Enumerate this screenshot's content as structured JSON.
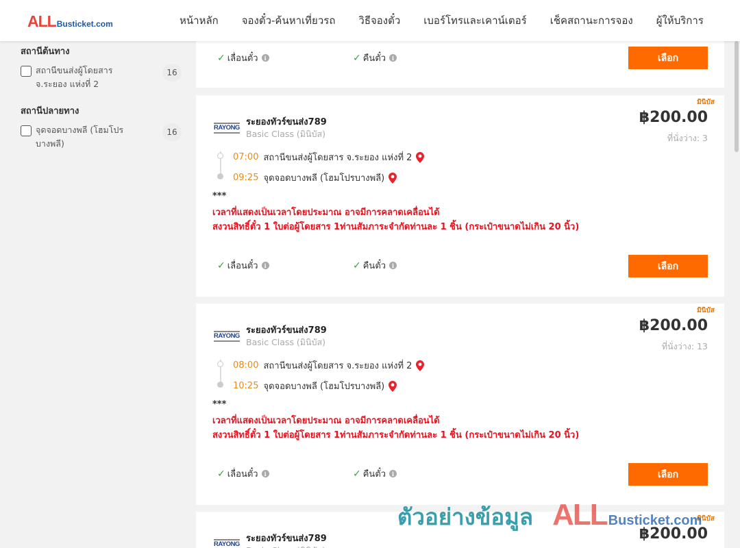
{
  "header": {
    "logo_big": "ALL",
    "logo_small": "Busticket.com",
    "nav": [
      {
        "label": "หน้าหลัก"
      },
      {
        "label": "จองตั๋ว-ค้นหาเที่ยวรถ"
      },
      {
        "label": "วิธีจองตั๋ว"
      },
      {
        "label": "เบอร์โทรและเคาน์เตอร์"
      },
      {
        "label": "เช็คสถานะการจอง"
      },
      {
        "label": "ผู้ให้บริการ"
      }
    ]
  },
  "sidebar": {
    "origin": {
      "title": "สถานีต้นทาง",
      "option_label": "สถานีขนส่งผู้โดยสาร จ.ระยอง แห่งที่ 2",
      "count": "16"
    },
    "destination": {
      "title": "สถานีปลายทาง",
      "option_label": "จุดจอดบางพลี (โฮมโปรบางพลี)",
      "count": "16"
    }
  },
  "features": {
    "change_label": "เลื่อนตั๋ว",
    "refund_label": "คืนตั๋ว",
    "info_glyph": "i",
    "select_label": "เลือก"
  },
  "trips": [
    {
      "badge": "มินิบัส",
      "logo_text": "RAYONG",
      "operator": "ระยองทัวร์ขนส่ง789",
      "class": "Basic Class (มินิบัส)",
      "price": "฿200.00",
      "seats": "ที่นั่งว่าง: 3",
      "depart_time": "07:00",
      "depart_place": "สถานีขนส่งผู้โดยสาร จ.ระยอง แห่งที่ 2",
      "arrive_time": "09:25",
      "arrive_place": "จุดจอดบางพลี (โฮมโปรบางพลี)",
      "stars": "***",
      "note1": "เวลาที่แสดงเป็นเวลาโดยประมาณ อาจมีการคลาดเคลื่อนได้",
      "note2": "สงวนสิทธิ์ตั๋ว 1 ใบต่อผู้โดยสาร 1ท่านสัมภาระจำกัดท่านละ 1 ชิ้น (กระเป๋าขนาดไม่เกิน 20 นิ้ว)"
    },
    {
      "badge": "มินิบัส",
      "logo_text": "RAYONG",
      "operator": "ระยองทัวร์ขนส่ง789",
      "class": "Basic Class (มินิบัส)",
      "price": "฿200.00",
      "seats": "ที่นั่งว่าง: 13",
      "depart_time": "08:00",
      "depart_place": "สถานีขนส่งผู้โดยสาร จ.ระยอง แห่งที่ 2",
      "arrive_time": "10:25",
      "arrive_place": "จุดจอดบางพลี (โฮมโปรบางพลี)",
      "stars": "***",
      "note1": "เวลาที่แสดงเป็นเวลาโดยประมาณ อาจมีการคลาดเคลื่อนได้",
      "note2": "สงวนสิทธิ์ตั๋ว 1 ใบต่อผู้โดยสาร 1ท่านสัมภาระจำกัดท่านละ 1 ชิ้น (กระเป๋าขนาดไม่เกิน 20 นิ้ว)"
    },
    {
      "badge": "มินิบัส",
      "logo_text": "RAYONG",
      "operator": "ระยองทัวร์ขนส่ง789",
      "class": "Basic Class (มินิบัส)",
      "price": "฿200.00"
    }
  ],
  "watermark": {
    "text": "ตัวอย่างข้อมูล",
    "brand_big": "ALL",
    "brand_small": "Busticket.com"
  },
  "colors": {
    "accent_orange": "#ff6a00",
    "time_orange": "#e98a1e",
    "warning_red": "#e8121f",
    "check_green": "#3aa241"
  }
}
